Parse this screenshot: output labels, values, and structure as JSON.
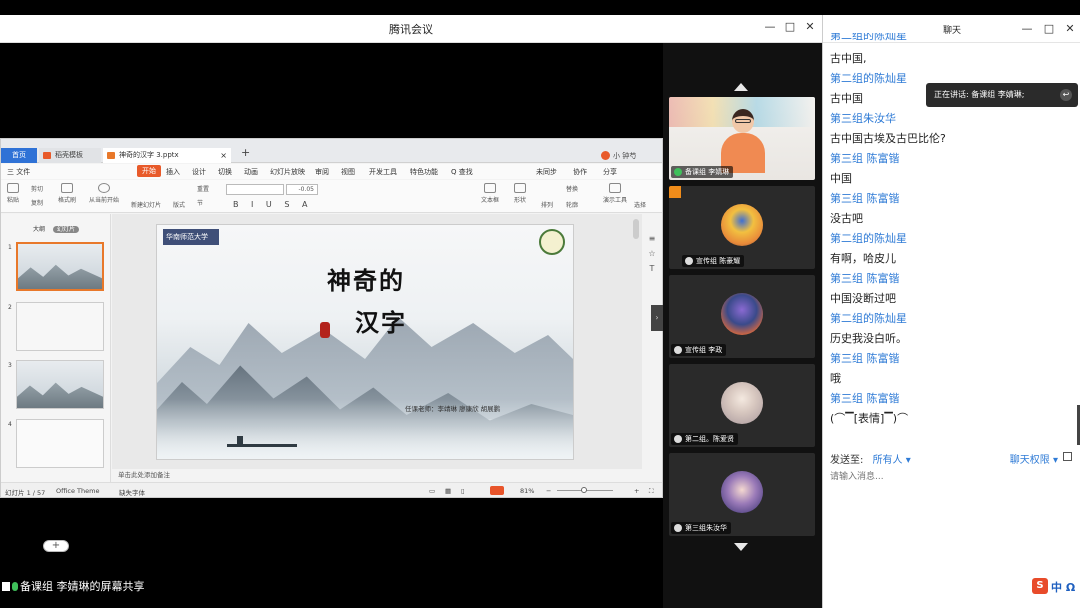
{
  "meeting": {
    "title": "腾讯会议",
    "controls": {
      "minimize": "—",
      "maximize": "□",
      "close": "✕"
    },
    "share_label": "备课组 李婧琳的屏幕共享"
  },
  "ppt": {
    "home_tab": "首页",
    "tabs": [
      {
        "label": "稻壳模板"
      },
      {
        "label": "神奇的汉字 3.pptx"
      }
    ],
    "user": "小 钟芍",
    "menu": [
      "三 文件",
      "开始",
      "插入",
      "设计",
      "切换",
      "动画",
      "幻灯片放映",
      "审阅",
      "视图",
      "开发工具",
      "特色功能",
      "Q 查找"
    ],
    "menu_right": [
      "未同步",
      "协作",
      "分享"
    ],
    "ribbon": {
      "paste": "粘贴",
      "cut": "剪切",
      "copy": "复制",
      "format_painter": "格式刷",
      "from_current": "从当前开始",
      "new_slide": "新建幻灯片",
      "layout": "版式",
      "reset": "重置",
      "section": "节",
      "font_size": "-0.05",
      "textbox": "文本框",
      "shapes": "形状",
      "arrange": "排列",
      "outline": "轮廓",
      "present_tools": "演示工具",
      "replace": "替换",
      "select": "选择"
    },
    "side_tabs": [
      "大纲",
      "幻灯片"
    ],
    "slide": {
      "uni_logo": "华南师范大学",
      "title_line1": "神奇的",
      "title_line2": "汉字",
      "teachers": "任课老师：李靖琳 廖康欣 胡展鹏"
    },
    "notes_placeholder": "单击此处添加备注",
    "status": {
      "slide_count": "幻灯片 1 / 57",
      "theme": "Office Theme",
      "font_missing": "缺失字体",
      "zoom": "81%"
    }
  },
  "participants": [
    {
      "name": "备课组 李婧琳",
      "type": "video",
      "mic": "on"
    },
    {
      "name": "宣传组 陈豪耀",
      "type": "avatar",
      "host": true
    },
    {
      "name": "宣传组 李政",
      "type": "avatar"
    },
    {
      "name": "第二组。陈爱贤",
      "type": "avatar"
    },
    {
      "name": "第三组朱汝华",
      "type": "avatar"
    }
  ],
  "chat": {
    "title": "聊天",
    "top_partial_name": "第二组的陈灿星",
    "messages": [
      {
        "text": "古中国,"
      },
      {
        "name": "第二组的陈灿星",
        "text": "古中国"
      },
      {
        "name": "第三组朱汝华",
        "text": "古中国古埃及古巴比伦?"
      },
      {
        "name": "第三组 陈富锴",
        "text": "中国"
      },
      {
        "name": "第三组 陈富锴",
        "text": "没古吧"
      },
      {
        "name": "第二组的陈灿星",
        "text": "有啊，哈皮儿"
      },
      {
        "name": "第三组 陈富锴",
        "text": "中国没断过吧"
      },
      {
        "name": "第二组的陈灿星",
        "text": "历史我没白听。"
      },
      {
        "name": "第三组 陈富锴",
        "text": "哦"
      },
      {
        "name": "第三组 陈富锴",
        "text": "(⌒▔[表情]▔)⌒"
      }
    ],
    "send_to_label": "发送至:",
    "send_to_value": "所有人 ▾",
    "permission": "聊天权限 ▾",
    "input_placeholder": "请输入消息..."
  },
  "speaking": {
    "label": "正在讲话: 备课组 李婧琳;"
  },
  "ime": {
    "text": "中 Ω",
    "logo": "S"
  }
}
